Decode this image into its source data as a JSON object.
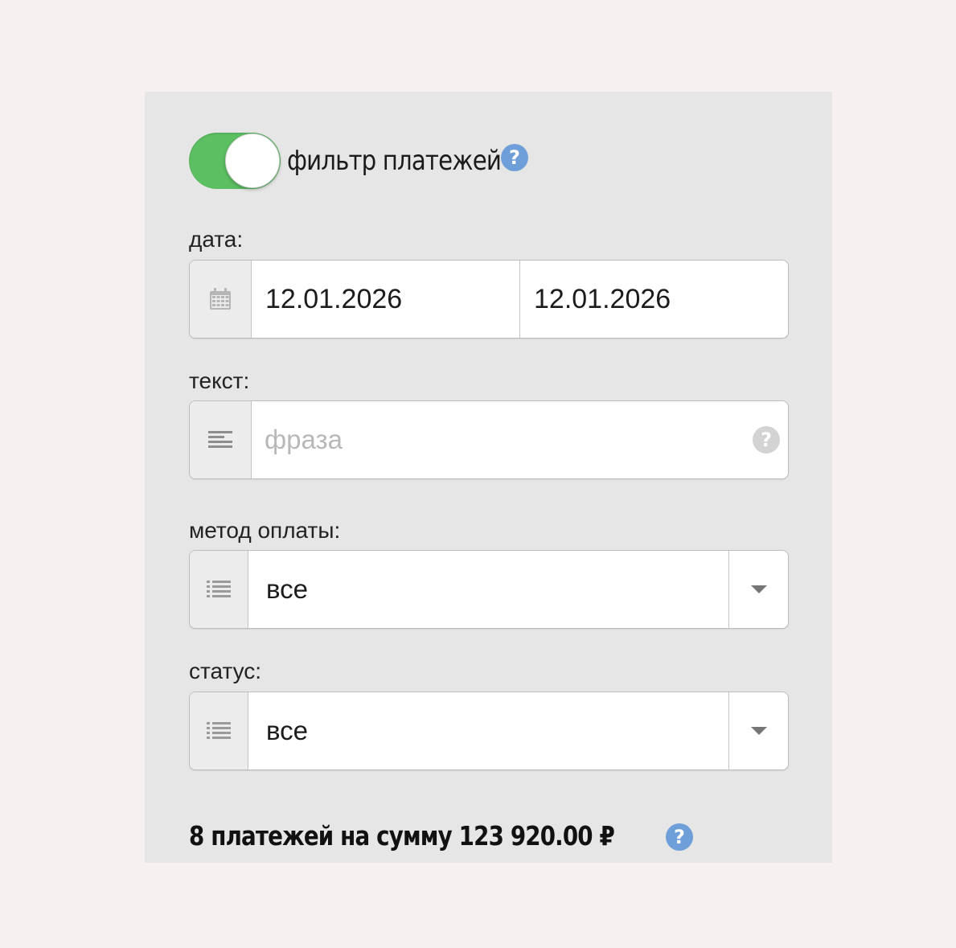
{
  "filter": {
    "label": "фильтр платежей",
    "enabled": true,
    "help": "?"
  },
  "date": {
    "label": "дата:",
    "from": "12.01.2026",
    "to": "12.01.2026"
  },
  "text": {
    "label": "текст:",
    "value": "",
    "placeholder": "фраза",
    "help": "?"
  },
  "payment_method": {
    "label": "метод оплаты:",
    "value": "все"
  },
  "status": {
    "label": "статус:",
    "value": "все"
  },
  "summary": {
    "text": "8 платежей на сумму 123 920.00 ₽",
    "help": "?"
  },
  "colors": {
    "toggle_on": "#5cbf62",
    "help_icon": "#6f9fd8",
    "panel": "#e6e6e6",
    "page": "#f6f0f0"
  }
}
